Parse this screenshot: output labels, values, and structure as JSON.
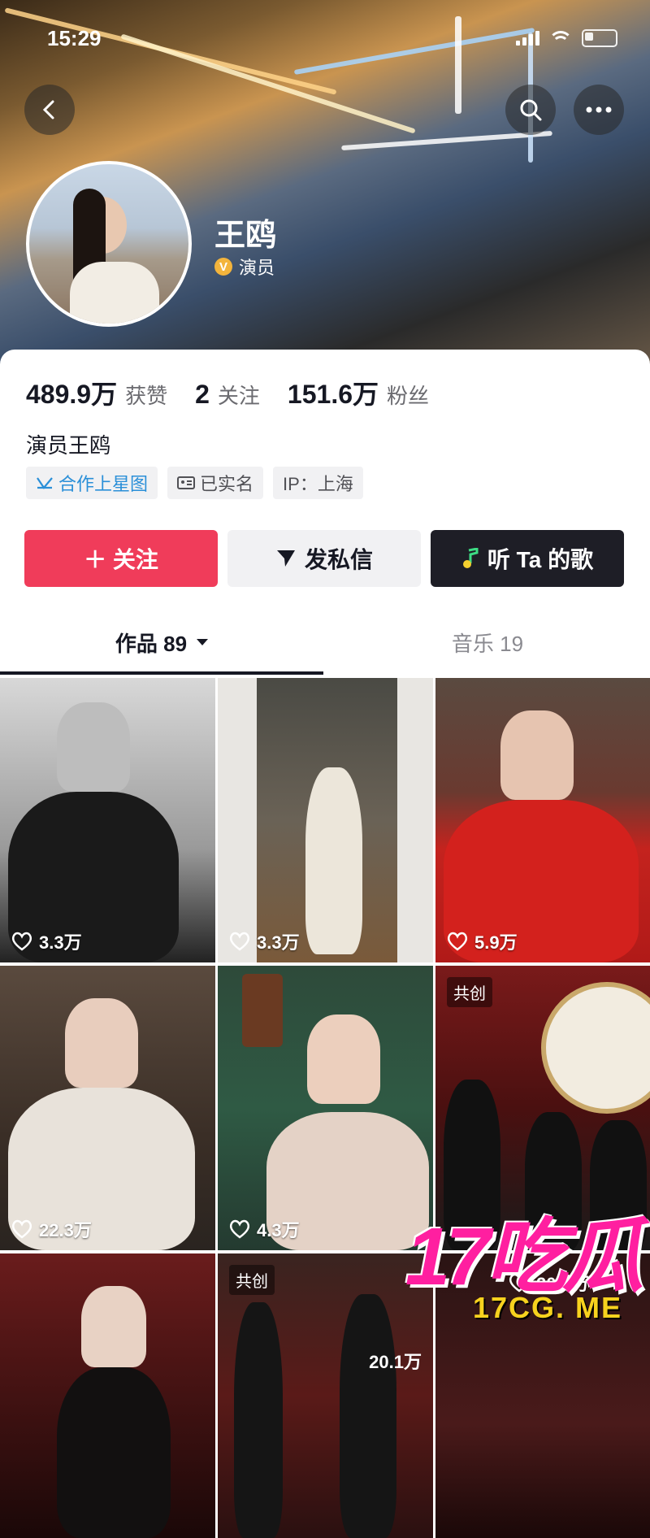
{
  "status_bar": {
    "time": "15:29"
  },
  "profile": {
    "name": "王鸥",
    "verified_label": "演员",
    "verified_badge": "V",
    "bio": "演员王鸥",
    "stats": [
      {
        "value": "489.9万",
        "label": "获赞"
      },
      {
        "value": "2",
        "label": "关注"
      },
      {
        "value": "151.6万",
        "label": "粉丝"
      }
    ],
    "tags": [
      "合作上星图",
      "已实名",
      "IP：上海"
    ]
  },
  "actions": {
    "follow": "＋ 关注",
    "message": "发私信",
    "song": "听 Ta 的歌"
  },
  "tabs": {
    "works": "作品 89",
    "music": "音乐 19"
  },
  "videos": [
    {
      "likes": "3.3万",
      "badge": ""
    },
    {
      "likes": "3.3万",
      "badge": ""
    },
    {
      "likes": "5.9万",
      "badge": ""
    },
    {
      "likes": "22.3万",
      "badge": ""
    },
    {
      "likes": "4.3万",
      "badge": ""
    },
    {
      "likes": "",
      "badge": "共创"
    },
    {
      "likes": "",
      "badge": ""
    },
    {
      "likes": "20.1万",
      "badge": "共创"
    },
    {
      "likes": "20.1万",
      "badge": ""
    }
  ],
  "watermark": {
    "logo_text": "17吃瓜",
    "site": "17CG. ME"
  },
  "colors": {
    "accent": "#f03c5a",
    "verified": "#f3b43c",
    "tag_blue": "#2a8fd8"
  }
}
